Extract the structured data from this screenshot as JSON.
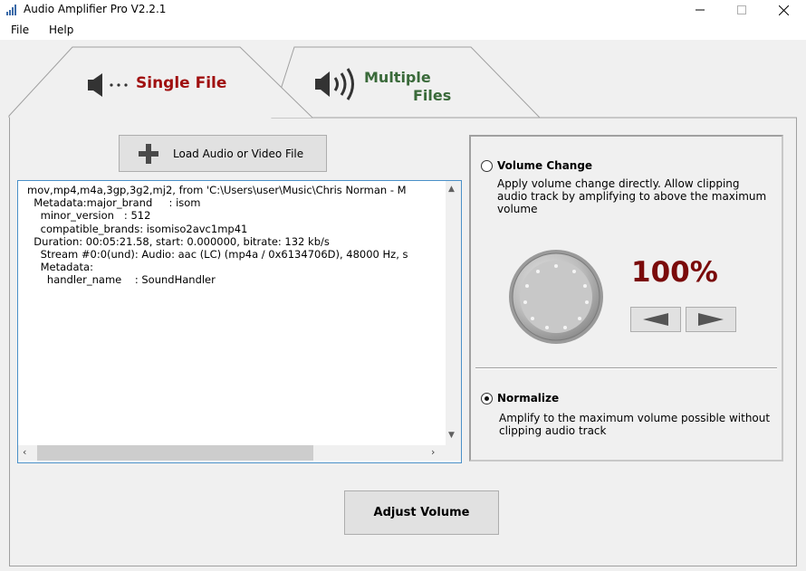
{
  "window": {
    "title": "Audio Amplifier Pro V2.2.1",
    "controls": [
      "minimize",
      "maximize",
      "close"
    ]
  },
  "menu": {
    "file": "File",
    "help": "Help"
  },
  "tabs": {
    "single": {
      "label": "Single File",
      "icon": "speaker-icon",
      "color": "#a01010",
      "active": true
    },
    "multiple": {
      "label_line1": "Multiple",
      "label_line2": "Files",
      "icon": "speaker-loud-icon",
      "color": "#3a6a3a",
      "active": false
    }
  },
  "load_button": {
    "label": "Load Audio or Video File",
    "icon": "plus-icon"
  },
  "info_box": {
    "lines": [
      "mov,mp4,m4a,3gp,3g2,mj2, from 'C:\\Users\\user\\Music\\Chris Norman - M",
      "  Metadata:major_brand     : isom",
      "    minor_version   : 512",
      "    compatible_brands: isomiso2avc1mp41",
      "  Duration: 00:05:21.58, start: 0.000000, bitrate: 132 kb/s",
      "    Stream #0:0(und): Audio: aac (LC) (mp4a / 0x6134706D), 48000 Hz, s",
      "    Metadata:",
      "      handler_name    : SoundHandler"
    ],
    "text": ""
  },
  "volume_change": {
    "label": "Volume Change",
    "checked": false,
    "description": "Apply volume change directly. Allow clipping audio track by amplifying to above the maximum volume",
    "percent": "100%",
    "knob_icon": "volume-knob-icon",
    "decrease_icon": "arrow-left-icon",
    "increase_icon": "arrow-right-icon"
  },
  "normalize": {
    "label": "Normalize",
    "checked": true,
    "description": "Amplify to the maximum volume possible without clipping audio track"
  },
  "adjust_button": {
    "label": "Adjust Volume"
  }
}
